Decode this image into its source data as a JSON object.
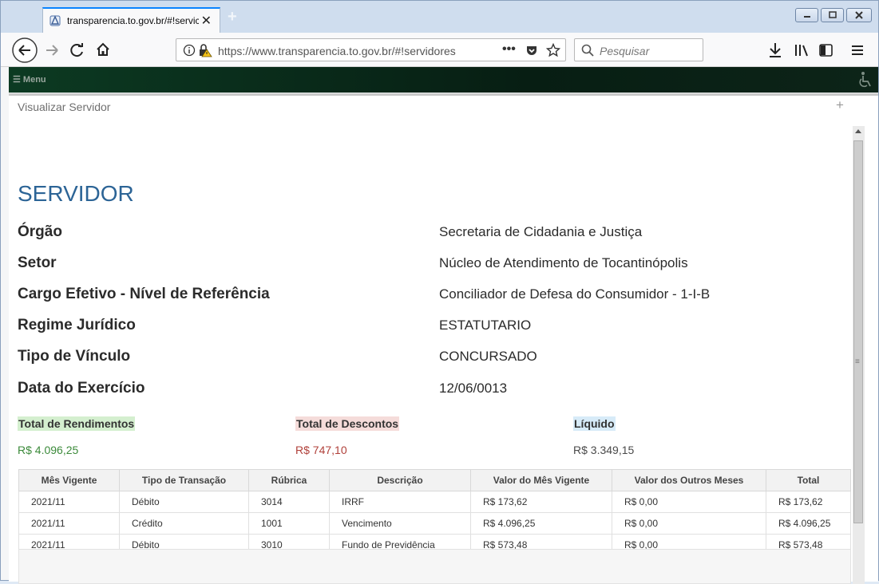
{
  "browser": {
    "tab_title": "transparencia.to.gov.br/#!servic",
    "url": "https://www.transparencia.to.gov.br/#!servidores",
    "search_placeholder": "Pesquisar"
  },
  "menu": {
    "label": "Menu"
  },
  "panel": {
    "title": "Visualizar Servidor"
  },
  "servidor": {
    "heading": "SERVIDOR",
    "fields": [
      {
        "label": "Órgão",
        "value": "Secretaria de Cidadania e Justiça"
      },
      {
        "label": "Setor",
        "value": "Núcleo de Atendimento de Tocantinópolis"
      },
      {
        "label": "Cargo Efetivo - Nível de Referência",
        "value": "Conciliador de Defesa do Consumidor - 1-I-B"
      },
      {
        "label": "Regime Jurídico",
        "value": "ESTATUTARIO"
      },
      {
        "label": "Tipo de Vínculo",
        "value": "CONCURSADO"
      },
      {
        "label": "Data do Exercício",
        "value": "12/06/0013"
      }
    ]
  },
  "totals": {
    "rendimentos": {
      "label": "Total de Rendimentos",
      "value": "R$ 4.096,25",
      "bg": "#d4efcf",
      "color": "#3b8a3a"
    },
    "descontos": {
      "label": "Total de Descontos",
      "value": "R$ 747,10",
      "bg": "#f5dcda",
      "color": "#b0403a"
    },
    "liquido": {
      "label": "Líquido",
      "value": "R$ 3.349,15",
      "bg": "#d7ebf8",
      "color": "#4a4a4a"
    }
  },
  "table": {
    "headers": [
      "Mês Vigente",
      "Tipo de Transação",
      "Rúbrica",
      "Descrição",
      "Valor do Mês Vigente",
      "Valor dos Outros Meses",
      "Total"
    ],
    "rows": [
      [
        "2021/11",
        "Débito",
        "3014",
        "IRRF",
        "R$ 173,62",
        "R$ 0,00",
        "R$ 173,62"
      ],
      [
        "2021/11",
        "Crédito",
        "1001",
        "Vencimento",
        "R$ 4.096,25",
        "R$ 0,00",
        "R$ 4.096,25"
      ],
      [
        "2021/11",
        "Débito",
        "3010",
        "Fundo de Previdência",
        "R$ 573,48",
        "R$ 0,00",
        "R$ 573,48"
      ]
    ]
  }
}
